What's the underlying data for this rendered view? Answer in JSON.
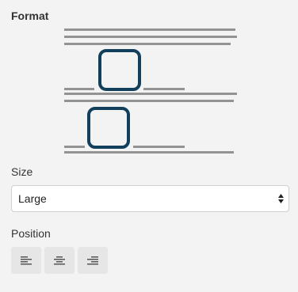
{
  "format": {
    "title": "Format"
  },
  "size": {
    "label": "Size",
    "selected": "Large",
    "arrows_icon": "up-down-arrows-icon"
  },
  "position": {
    "label": "Position",
    "buttons": [
      {
        "name": "align-left-button",
        "icon": "align-left-icon"
      },
      {
        "name": "align-center-button",
        "icon": "align-center-icon"
      },
      {
        "name": "align-right-button",
        "icon": "align-right-icon"
      }
    ]
  },
  "colors": {
    "line": "#939393",
    "frame": "#123f5c",
    "background": "#f3f3f3",
    "button": "#e6e6e6"
  }
}
